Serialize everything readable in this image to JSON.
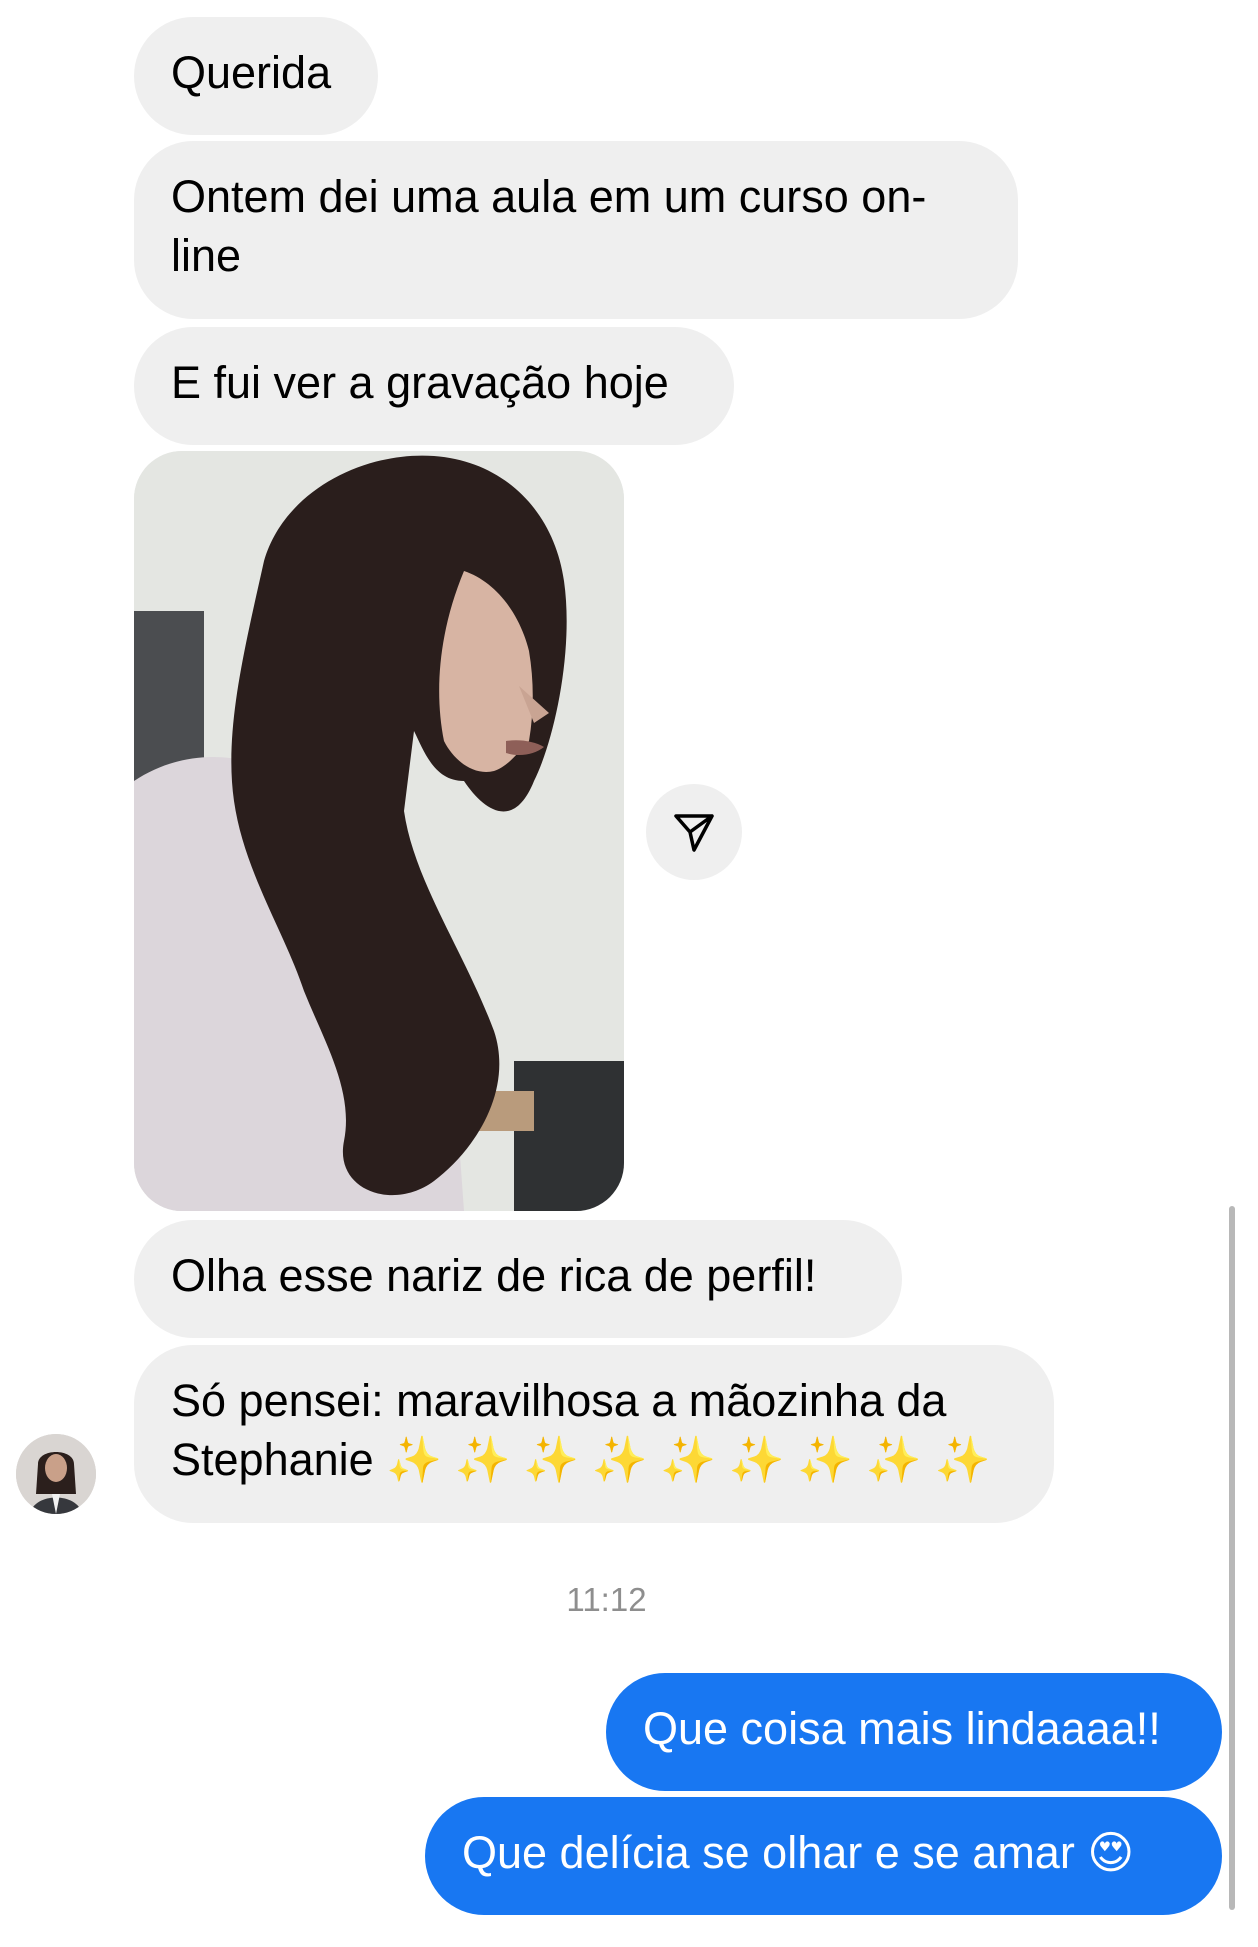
{
  "messages_received": [
    {
      "text": "Querida"
    },
    {
      "text": "Ontem dei uma aula em um curso on-\nline"
    },
    {
      "text": "E fui ver a gravação hoje"
    },
    {
      "text": "Olha esse nariz de rica de perfil!"
    },
    {
      "text": "Só pensei: maravilhosa a mãozinha da\nStephanie ✨ ✨ ✨ ✨ ✨ ✨ ✨ ✨ ✨"
    }
  ],
  "timestamp": "11:12",
  "messages_sent": [
    {
      "text": "Que coisa mais lindaaaa!!"
    },
    {
      "text": "Que delícia se olhar e se amar 😍"
    }
  ],
  "icons": {
    "share": "send-icon"
  },
  "colors": {
    "received_bubble": "#efefef",
    "sent_bubble": "#1877f2",
    "timestamp": "#8e8e8e"
  }
}
